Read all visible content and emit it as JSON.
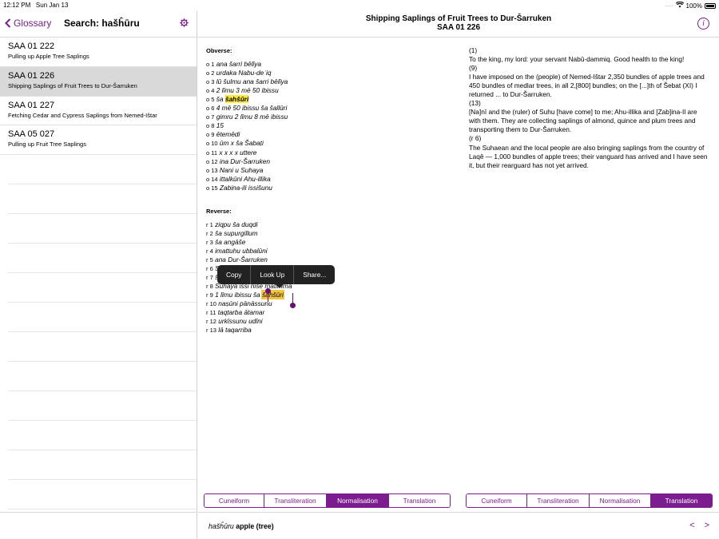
{
  "status": {
    "time": "12:12 PM",
    "date": "Sun Jan 13",
    "battery": "100%"
  },
  "sidebar": {
    "back_label": "Glossary",
    "title": "Search: hašĥūru",
    "items": [
      {
        "code": "SAA 01 222",
        "desc": "Pulling up Apple Tree Saplings"
      },
      {
        "code": "SAA 01 226",
        "desc": "Shipping Saplings of Fruit Trees to Dur-Šarruken"
      },
      {
        "code": "SAA 01 227",
        "desc": "Fetching Cedar and Cypress Saplings from Nemed-Ištar"
      },
      {
        "code": "SAA 05 027",
        "desc": "Pulling up Fruit Tree Saplings"
      }
    ]
  },
  "header": {
    "title": "Shipping Saplings of Fruit Trees to Dur-Šarruken",
    "code": "SAA 01 226"
  },
  "obverse": {
    "title": "Obverse:",
    "lines": [
      {
        "n": "o 1",
        "t": "ana šarri bēlīya"
      },
      {
        "n": "o 2",
        "t": "urdaka Nabu-deʾiq"
      },
      {
        "n": "o 3",
        "t": "lū šulmu ana šarri bēlīya"
      },
      {
        "n": "o 4",
        "t": "2 līmu 3 mē 50 ibissu"
      },
      {
        "n": "o 5",
        "t": "ša",
        "h": "šahšūri"
      },
      {
        "n": "o 6",
        "t": "4 mē 50 ibissu ša šallūri"
      },
      {
        "n": "o 7",
        "t": "gimru 2 līmu 8 mē ibissu"
      },
      {
        "n": "o 8",
        "t": "15"
      },
      {
        "n": "o 9",
        "t": "ētemēdi"
      },
      {
        "n": "o 10",
        "t": "ūm x ša Šabaṭi"
      },
      {
        "n": "o 11",
        "t": "x x x x uttere"
      },
      {
        "n": "o 12",
        "t": "ina Dur-Šarruken"
      },
      {
        "n": "o 13",
        "t": "Nani u Suhaya"
      },
      {
        "n": "o 14",
        "t": "ittalkūni Ahu-illika"
      },
      {
        "n": "o 15",
        "t": "Zabina-ili issišunu"
      }
    ]
  },
  "reverse": {
    "title": "Reverse:",
    "lines": [
      {
        "n": "r 1",
        "t": "ziqpu ša duqdi"
      },
      {
        "n": "r 2",
        "t": "ša supurgillum"
      },
      {
        "n": "r 3",
        "t": "ša angāše"
      },
      {
        "n": "r 4",
        "t": "imattuhu ubbalūni"
      },
      {
        "n": "r 5",
        "t": "ana Dur-Šarruken"
      },
      {
        "n": "r 6",
        "t": "Suhaya u"
      },
      {
        "n": "r 7",
        "t": "ša māti"
      },
      {
        "n": "r 8",
        "t": "Suhaya issi nišē mātimma"
      },
      {
        "n": "r 9",
        "t": "1 līmu ibissu ša",
        "s": "šahšūri"
      },
      {
        "n": "r 10",
        "t": "naṣūni pānāssunu"
      },
      {
        "n": "r 11",
        "t": "taqṭarba ātamar"
      },
      {
        "n": "r 12",
        "t": "urkīssunu udīni"
      },
      {
        "n": "r 13",
        "t": "lā taqarriba"
      }
    ]
  },
  "translation": [
    "(1)",
    "To the king, my lord: your servant Nabû-dammiq. Good health to the king!",
    "(9)",
    "I have imposed on the (people) of Nemed-Ištar 2,350 bundles of apple trees and 450 bundles of medlar trees, in all 2,[800] bundles; on the [...]th of Šebat (XI) I returned ... to Dur-Šarruken.",
    "(13)",
    "[Na]nī and the (ruler) of Suhu [have come] to me; Ahu-illika and [Zab]ina-Il are with them. They are collecting saplings of almond, quince and plum trees and transporting them to Dur-Šarruken.",
    "(r 6)",
    "The Suhaean and the local people are also bringing saplings from the country of Laqê — 1,000 bundles of apple trees; their vanguard has arrived and I have seen it, but their rearguard has not yet arrived."
  ],
  "context_menu": [
    "Copy",
    "Look Up",
    "Share..."
  ],
  "tabs_left": [
    "Cuneiform",
    "Transliteration",
    "Normalisation",
    "Translation"
  ],
  "tabs_left_active": "Normalisation",
  "tabs_right": [
    "Cuneiform",
    "Transliteration",
    "Normalisation",
    "Translation"
  ],
  "tabs_right_active": "Translation",
  "footer": {
    "word": "hašĥūru",
    "gloss": "apple (tree)",
    "prev": "<",
    "next": ">"
  },
  "colors": {
    "accent": "#7b1d8e",
    "highlight": "#ffeb3b",
    "selected_row": "#d9d9d9"
  }
}
